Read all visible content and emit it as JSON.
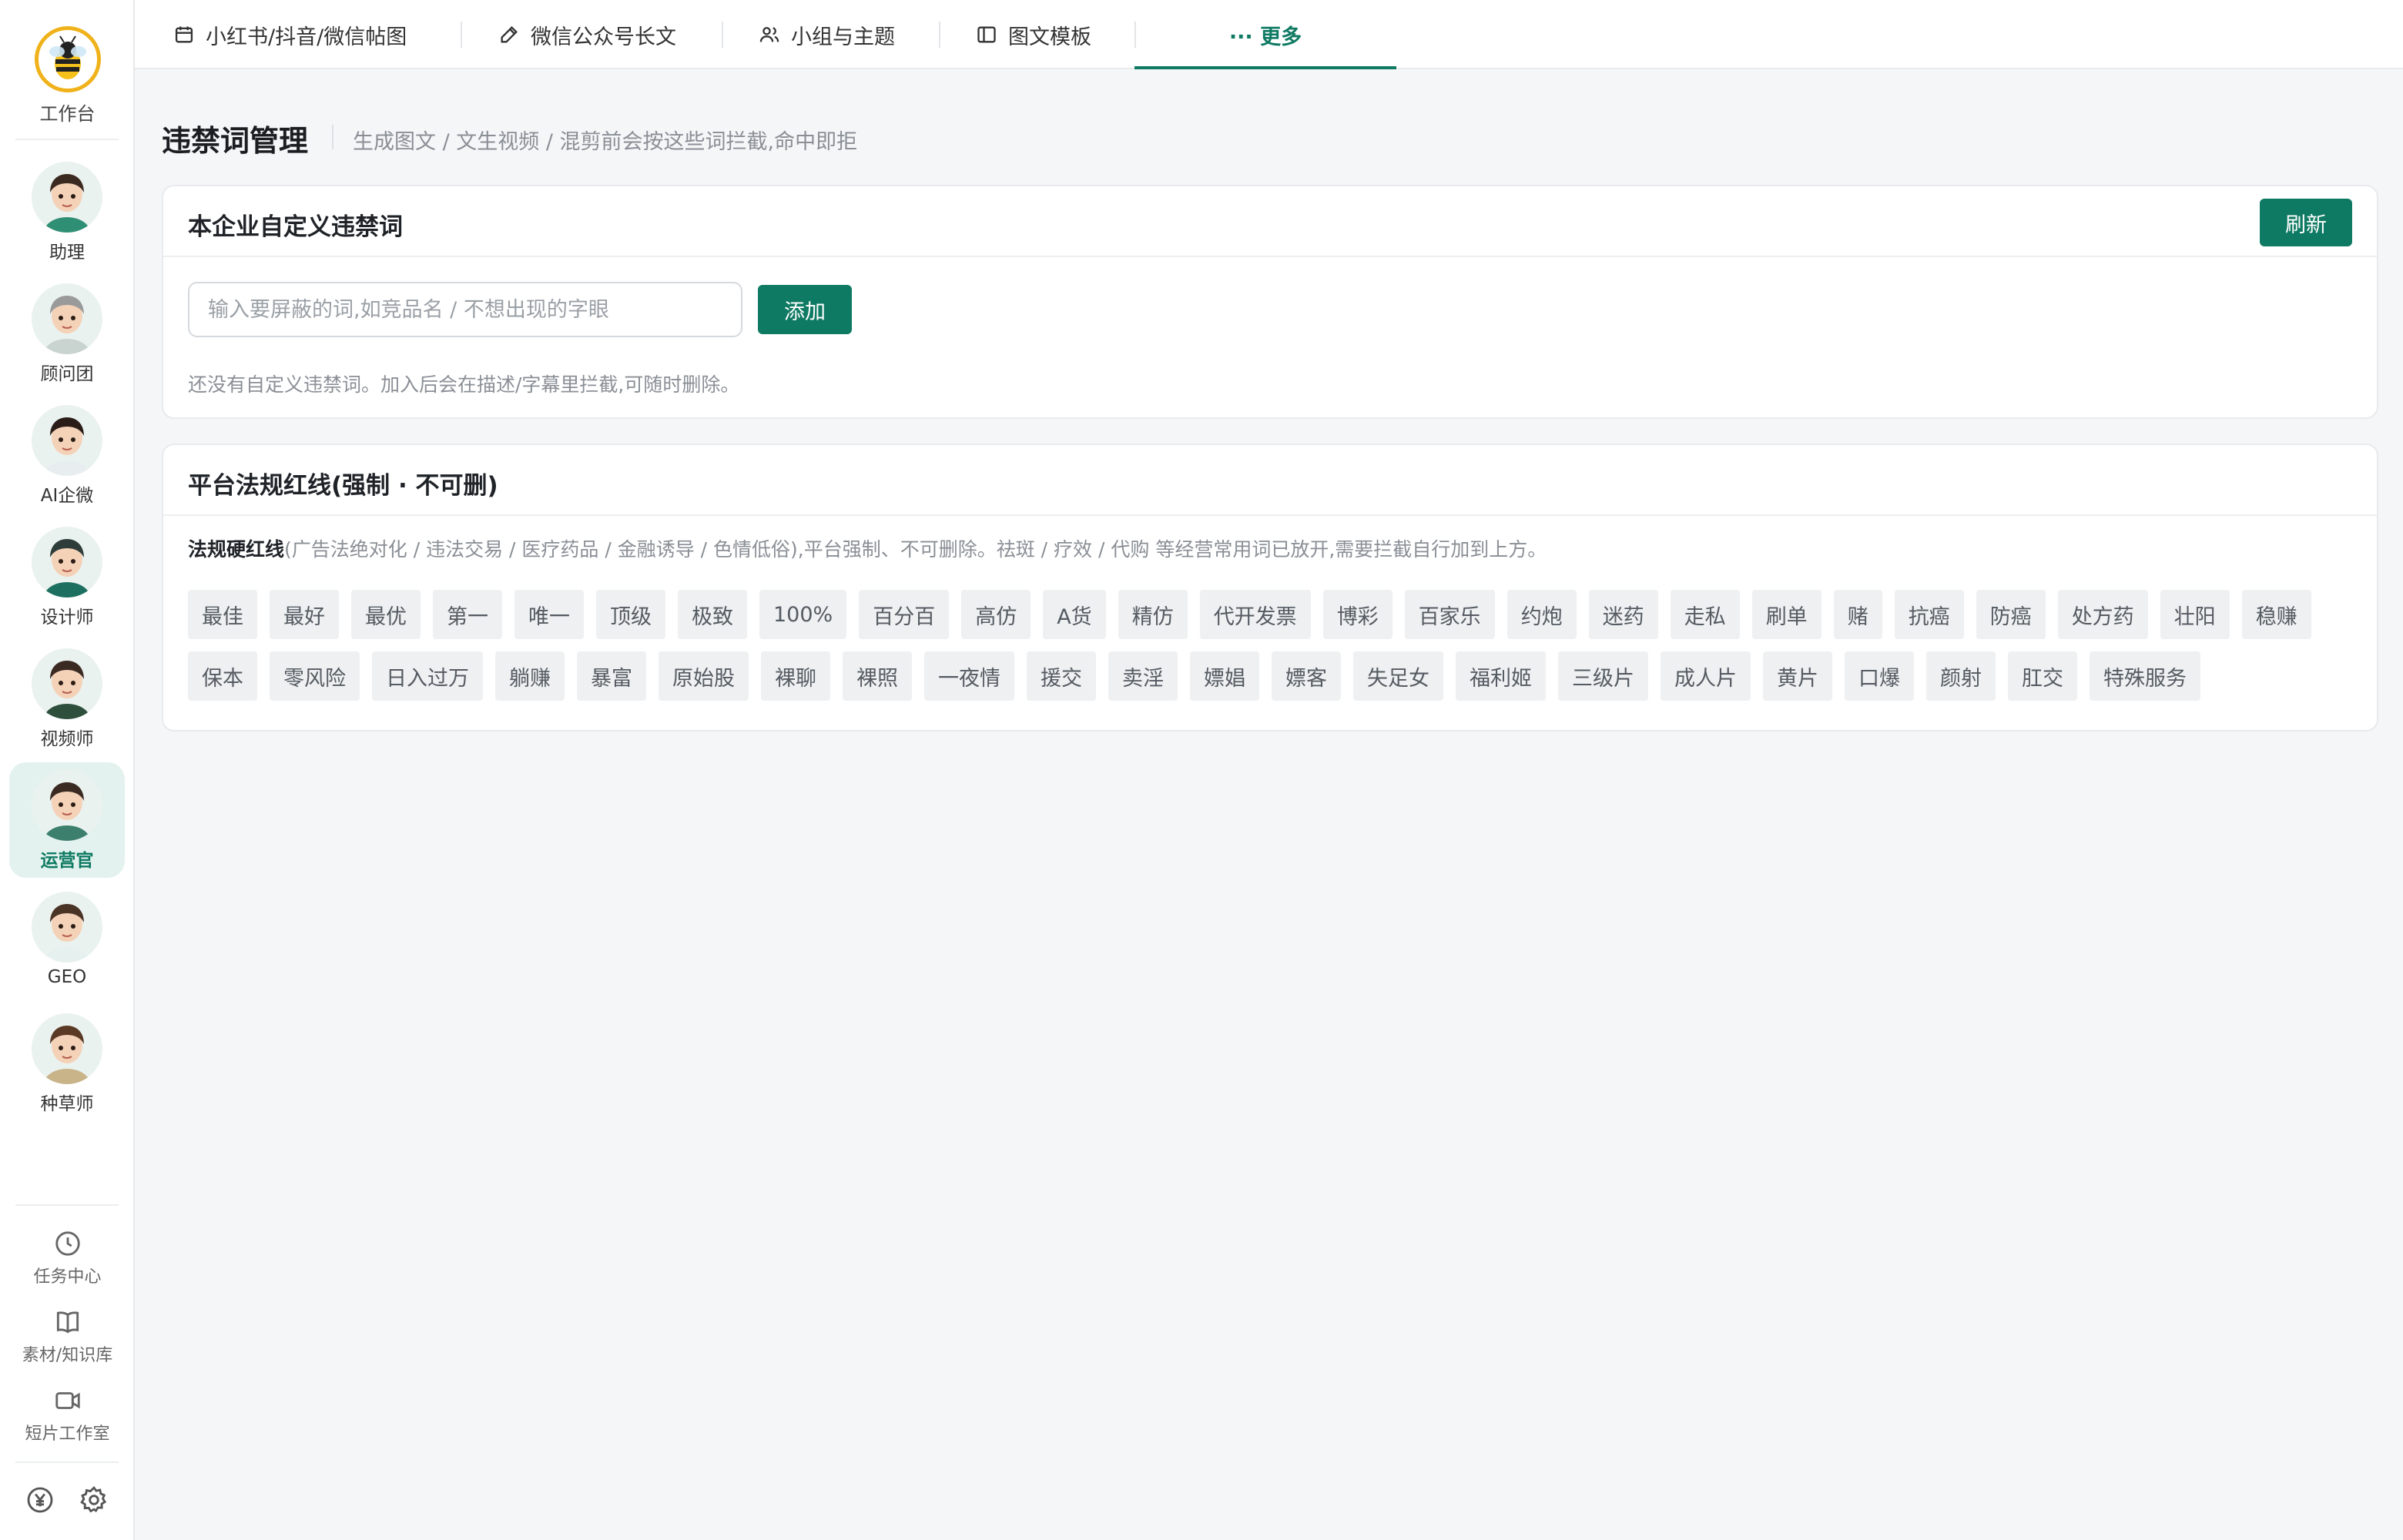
{
  "sidebar": {
    "logo_label": "工作台",
    "agents": [
      {
        "label": "助理"
      },
      {
        "label": "顾问团"
      },
      {
        "label": "AI企微"
      },
      {
        "label": "设计师"
      },
      {
        "label": "视频师"
      },
      {
        "label": "运营官"
      },
      {
        "label": "GEO"
      },
      {
        "label": "种草师"
      }
    ],
    "active_agent": "运营官",
    "tools": [
      {
        "label": "任务中心",
        "icon": "clock-icon"
      },
      {
        "label": "素材/知识库",
        "icon": "book-icon"
      },
      {
        "label": "短片工作室",
        "icon": "video-icon"
      }
    ],
    "bottom_icons": [
      "yen-icon",
      "gear-icon"
    ]
  },
  "tabs": [
    {
      "label": "小红书/抖音/微信帖图",
      "icon": "calendar-icon"
    },
    {
      "label": "微信公众号长文",
      "icon": "pencil-icon"
    },
    {
      "label": "小组与主题",
      "icon": "users-icon"
    },
    {
      "label": "图文模板",
      "icon": "layout-icon"
    },
    {
      "label": "··· 更多",
      "icon": "more-icon",
      "active": true
    }
  ],
  "page": {
    "title": "违禁词管理",
    "subtitle": "生成图文 / 文生视频 / 混剪前会按这些词拦截,命中即拒"
  },
  "custom_card": {
    "title": "本企业自定义违禁词",
    "refresh_label": "刷新",
    "input_placeholder": "输入要屏蔽的词,如竞品名 / 不想出现的字眼",
    "add_label": "添加",
    "empty_hint": "还没有自定义违禁词。加入后会在描述/字幕里拦截,可随时删除。"
  },
  "platform_card": {
    "title": "平台法规红线(强制 · 不可删)",
    "rule_bold": "法规硬红线",
    "rule_text": "(广告法绝对化 / 违法交易 / 医疗药品 / 金融诱导 / 色情低俗),平台强制、不可删除。祛斑 / 疗效 / 代购 等经营常用词已放开,需要拦截自行加到上方。",
    "words": [
      "最佳",
      "最好",
      "最优",
      "第一",
      "唯一",
      "顶级",
      "极致",
      "100%",
      "百分百",
      "高仿",
      "A货",
      "精仿",
      "代开发票",
      "博彩",
      "百家乐",
      "约炮",
      "迷药",
      "走私",
      "刷单",
      "赌",
      "抗癌",
      "防癌",
      "处方药",
      "壮阳",
      "稳赚",
      "保本",
      "零风险",
      "日入过万",
      "躺赚",
      "暴富",
      "原始股",
      "裸聊",
      "裸照",
      "一夜情",
      "援交",
      "卖淫",
      "嫖娼",
      "嫖客",
      "失足女",
      "福利姬",
      "三级片",
      "成人片",
      "黄片",
      "口爆",
      "颜射",
      "肛交",
      "特殊服务"
    ]
  },
  "colors": {
    "accent": "#0f7a63",
    "logo_ring": "#f0b21a",
    "active_bg": "#e3f2ee"
  }
}
